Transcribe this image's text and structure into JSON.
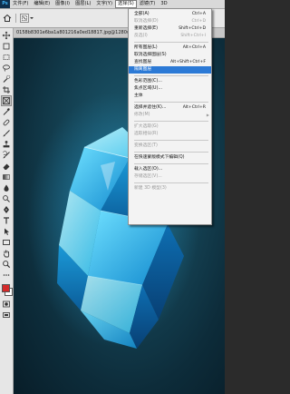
{
  "app": {
    "logo_text": "Ps"
  },
  "menubar": {
    "items": [
      {
        "label": "文件(F)"
      },
      {
        "label": "编辑(E)"
      },
      {
        "label": "图像(I)"
      },
      {
        "label": "图层(L)"
      },
      {
        "label": "文字(Y)"
      },
      {
        "label": "选择(S)",
        "active": true
      },
      {
        "label": "滤镜(T)"
      },
      {
        "label": "3D"
      }
    ]
  },
  "document": {
    "tab_title": "0158b8301e6ba1a801216a0ed18817.jpg@1280w_1l_2o_100sh.jpg"
  },
  "select_menu": {
    "items": [
      {
        "label": "全部(A)",
        "shortcut": "Ctrl+A",
        "disabled": false
      },
      {
        "label": "取消选择(D)",
        "shortcut": "Ctrl+D",
        "disabled": true
      },
      {
        "label": "重新选择(E)",
        "shortcut": "Shift+Ctrl+D",
        "disabled": false
      },
      {
        "label": "反选(I)",
        "shortcut": "Shift+Ctrl+I",
        "disabled": true
      },
      {
        "separator": true
      },
      {
        "label": "所有图层(L)",
        "shortcut": "Alt+Ctrl+A",
        "disabled": false
      },
      {
        "label": "取消选择图层(S)",
        "shortcut": "",
        "disabled": false
      },
      {
        "label": "查找图层",
        "shortcut": "Alt+Shift+Ctrl+F",
        "disabled": false
      },
      {
        "label": "隔离图层",
        "shortcut": "",
        "disabled": false,
        "highlighted": true
      },
      {
        "separator": true
      },
      {
        "label": "色彩范围(C)...",
        "shortcut": "",
        "disabled": false
      },
      {
        "label": "焦点区域(U)...",
        "shortcut": "",
        "disabled": false
      },
      {
        "label": "主体",
        "shortcut": "",
        "disabled": false
      },
      {
        "separator": true
      },
      {
        "label": "选择并遮住(K)...",
        "shortcut": "Alt+Ctrl+R",
        "disabled": false
      },
      {
        "label": "修改(M)",
        "shortcut": "",
        "disabled": true,
        "submenu": true
      },
      {
        "separator": true
      },
      {
        "label": "扩大选取(G)",
        "shortcut": "",
        "disabled": true
      },
      {
        "label": "选取相似(R)",
        "shortcut": "",
        "disabled": true
      },
      {
        "separator": true
      },
      {
        "label": "变换选区(T)",
        "shortcut": "",
        "disabled": true
      },
      {
        "separator": true
      },
      {
        "label": "在快速蒙版模式下编辑(Q)",
        "shortcut": "",
        "disabled": false
      },
      {
        "separator": true
      },
      {
        "label": "载入选区(O)...",
        "shortcut": "",
        "disabled": false
      },
      {
        "label": "存储选区(V)...",
        "shortcut": "",
        "disabled": true
      },
      {
        "separator": true
      },
      {
        "label": "新建 3D 模型(3)",
        "shortcut": "",
        "disabled": true
      }
    ]
  },
  "colors": {
    "highlight": "#2c7ad6",
    "foreground_swatch": "#d42a2a",
    "background_swatch": "#ffffff",
    "canvas_background": "#154456",
    "crystal_light": "#7fe6ff",
    "crystal_mid": "#1ba5e2",
    "crystal_dark": "#0a4f86"
  },
  "icons": {
    "options_bar": [
      "home-icon",
      "selection-tool-preset-icon"
    ],
    "tools": [
      "move-tool-icon",
      "artboard-tool-icon",
      "rectangular-marquee-tool-icon",
      "lasso-tool-icon",
      "quick-selection-tool-icon",
      "crop-tool-icon",
      "frame-tool-icon",
      "eyedropper-tool-icon",
      "spot-healing-brush-icon",
      "brush-tool-icon",
      "clone-stamp-tool-icon",
      "history-brush-icon",
      "eraser-tool-icon",
      "gradient-tool-icon",
      "blur-tool-icon",
      "dodge-tool-icon",
      "pen-tool-icon",
      "type-tool-icon",
      "path-selection-tool-icon",
      "rectangle-tool-icon",
      "hand-tool-icon",
      "zoom-tool-icon",
      "more-tools-icon",
      "color-swatches-icon",
      "quick-mask-icon",
      "screen-mode-icon"
    ]
  }
}
